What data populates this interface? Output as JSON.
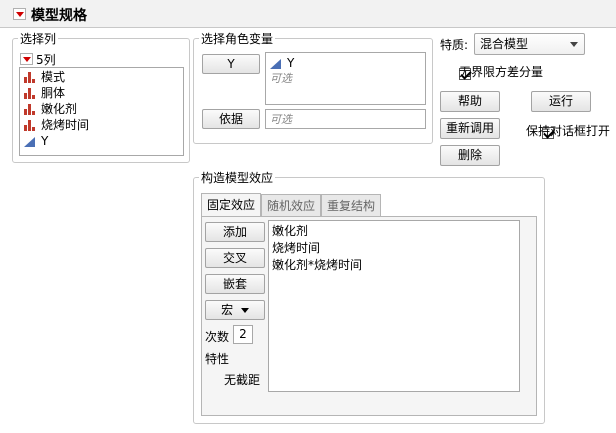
{
  "title": "模型规格",
  "select_columns": {
    "legend": "选择列",
    "count_label": "5列",
    "columns": [
      {
        "name": "模式",
        "type": "nominal"
      },
      {
        "name": "胴体",
        "type": "nominal"
      },
      {
        "name": "嫩化剂",
        "type": "nominal"
      },
      {
        "name": "烧烤时间",
        "type": "nominal"
      },
      {
        "name": "Y",
        "type": "continuous"
      }
    ]
  },
  "roles": {
    "legend": "选择角色变量",
    "y_button": "Y",
    "y_value": "Y",
    "y_placeholder": "可选",
    "by_button": "依据",
    "by_placeholder": "可选"
  },
  "personality": {
    "label": "特质:",
    "selected": "混合模型",
    "unbounded_label": "无界限方差分量",
    "unbounded_checked": true
  },
  "actions": {
    "help": "帮助",
    "run": "运行",
    "recall": "重新调用",
    "keep_open": "保持对话框打开",
    "keep_open_checked": true,
    "remove": "删除"
  },
  "effects": {
    "legend": "构造模型效应",
    "tabs": [
      "固定效应",
      "随机效应",
      "重复结构"
    ],
    "active_tab": 0,
    "add": "添加",
    "cross": "交叉",
    "nest": "嵌套",
    "macros": "宏",
    "degree_label": "次数",
    "degree_value": "2",
    "attributes_label": "特性",
    "no_intercept": "无截距",
    "no_intercept_checked": false,
    "items": [
      "嫩化剂",
      "烧烤时间",
      "嫩化剂*烧烤时间"
    ]
  }
}
